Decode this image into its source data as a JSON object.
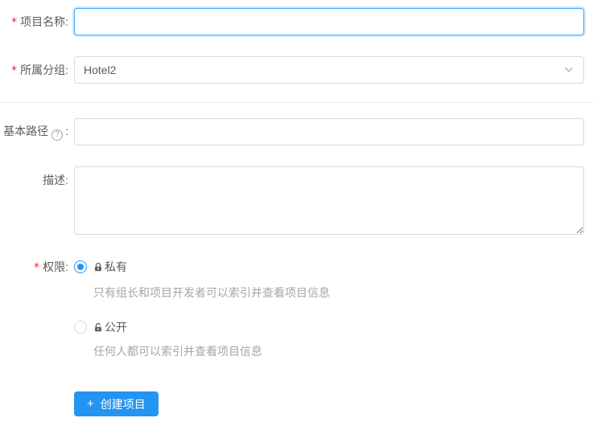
{
  "form": {
    "required_mark": "*",
    "colon": ":",
    "project_name": {
      "label": "项目名称",
      "value": ""
    },
    "group": {
      "label": "所属分组",
      "value": "Hotel2"
    },
    "base_path": {
      "label": "基本路径",
      "help_glyph": "?"
    },
    "description": {
      "label": "描述",
      "value": ""
    },
    "permission": {
      "label": "权限",
      "private": {
        "label": "私有",
        "hint": "只有组长和项目开发者可以索引并查看项目信息",
        "selected": true
      },
      "public": {
        "label": "公开",
        "hint": "任何人都可以索引并查看项目信息",
        "selected": false
      }
    },
    "submit": {
      "plus": "+",
      "label": "创建项目"
    }
  },
  "colors": {
    "primary": "#2395f1",
    "focus_border": "#40a9ff",
    "input_border": "#d9d9d9",
    "divider": "#e8e8e8",
    "label_text": "#5c5c5c",
    "hint_text": "#a6a6a6",
    "required_mark": "#f5222d"
  }
}
